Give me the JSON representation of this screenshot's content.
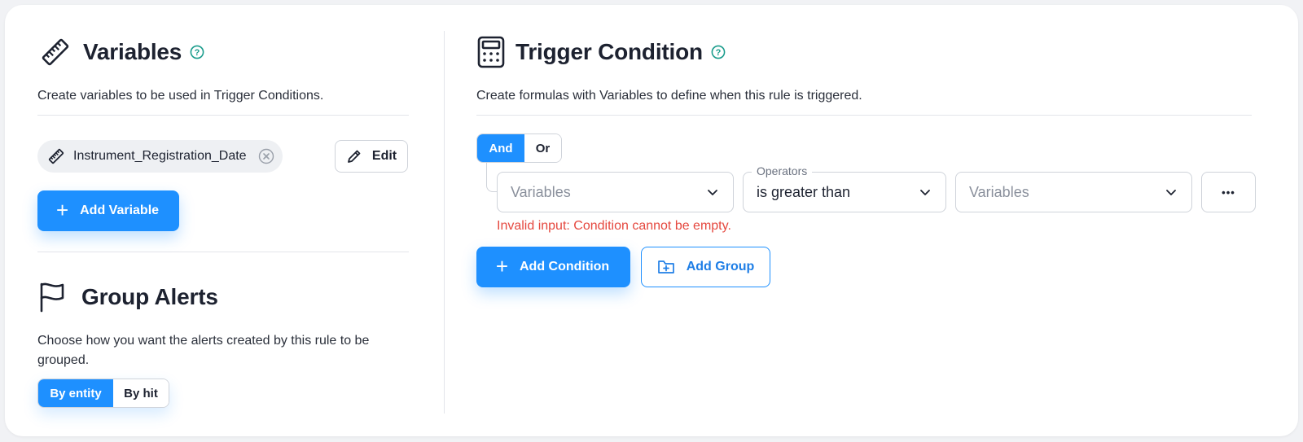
{
  "variables": {
    "title": "Variables",
    "subtitle": "Create variables to be used in Trigger Conditions.",
    "chips": [
      {
        "label": "Instrument_Registration_Date"
      }
    ],
    "edit_label": "Edit",
    "add_label": "Add Variable"
  },
  "group_alerts": {
    "title": "Group Alerts",
    "subtitle": "Choose how you want the alerts created by this rule to be grouped.",
    "options": [
      "By entity",
      "By hit"
    ],
    "selected": "By entity"
  },
  "trigger": {
    "title": "Trigger Condition",
    "subtitle": "Create formulas with Variables to define when this rule is triggered.",
    "logic_options": [
      "And",
      "Or"
    ],
    "logic_selected": "And",
    "condition": {
      "left_placeholder": "Variables",
      "operator_label": "Operators",
      "operator_value": "is greater than",
      "right_placeholder": "Variables",
      "more_label": "•••"
    },
    "error": "Invalid input: Condition cannot be empty.",
    "add_condition_label": "Add Condition",
    "add_group_label": "Add Group"
  },
  "colors": {
    "accent": "#1e90ff",
    "help": "#1a9c8c",
    "error": "#e5483f"
  },
  "icons": [
    "ruler-icon",
    "help-circle-icon",
    "flag-icon",
    "calculator-icon",
    "close-circle-icon",
    "pencil-icon",
    "plus-icon",
    "chevron-down-icon",
    "folder-plus-icon",
    "more-icon"
  ]
}
